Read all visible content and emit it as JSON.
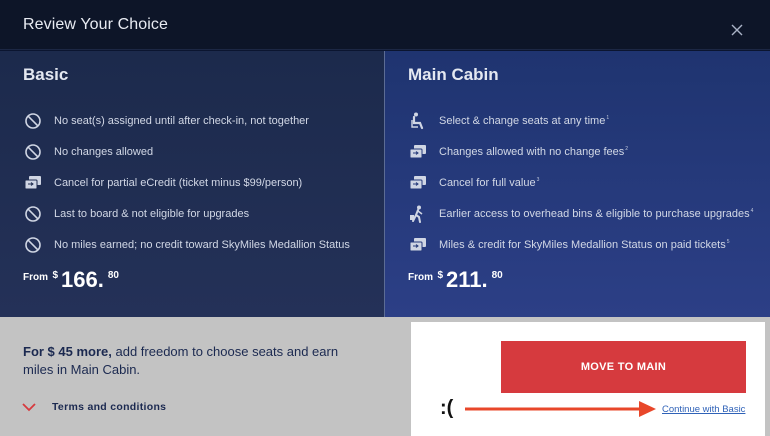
{
  "modal": {
    "title": "Review Your Choice",
    "close_icon": "close-icon"
  },
  "basic": {
    "name": "Basic",
    "features": [
      {
        "icon": "no-icon",
        "text": "No seat(s) assigned until after check-in, not together",
        "note": ""
      },
      {
        "icon": "no-icon",
        "text": "No changes allowed",
        "note": ""
      },
      {
        "icon": "ticket-icon",
        "text": "Cancel for partial eCredit (ticket minus $99/person)",
        "note": ""
      },
      {
        "icon": "no-icon",
        "text": "Last to board & not eligible for upgrades",
        "note": ""
      },
      {
        "icon": "no-icon",
        "text": "No miles earned; no credit toward SkyMiles Medallion Status",
        "note": ""
      }
    ],
    "price": {
      "from": "From",
      "currency": "$",
      "whole": "166.",
      "cents": "80"
    }
  },
  "main": {
    "name": "Main Cabin",
    "features": [
      {
        "icon": "seat-icon",
        "text": "Select & change seats at any time",
        "note": "1"
      },
      {
        "icon": "ticket-icon",
        "text": "Changes allowed with no change fees",
        "note": "2"
      },
      {
        "icon": "ticket-icon",
        "text": "Cancel for full value",
        "note": "3"
      },
      {
        "icon": "traveler-icon",
        "text": "Earlier access to overhead bins & eligible to purchase upgrades",
        "note": "4"
      },
      {
        "icon": "ticket-icon",
        "text": "Miles & credit for SkyMiles Medallion Status on paid tickets",
        "note": "5"
      }
    ],
    "price": {
      "from": "From",
      "currency": "$",
      "whole": "211.",
      "cents": "80"
    }
  },
  "footer": {
    "upsell_bold": "For $ 45 more,",
    "upsell_rest": " add freedom to choose seats and earn miles in Main Cabin.",
    "terms_label": "Terms and conditions"
  },
  "actions": {
    "move_label": "MOVE TO MAIN",
    "continue_label": "Continue with Basic",
    "annotation_text": ":("
  },
  "colors": {
    "accent_red": "#d63a3e",
    "link_blue": "#2f62b8",
    "arrow_red": "#e8472a",
    "navy": "#1b2950"
  }
}
